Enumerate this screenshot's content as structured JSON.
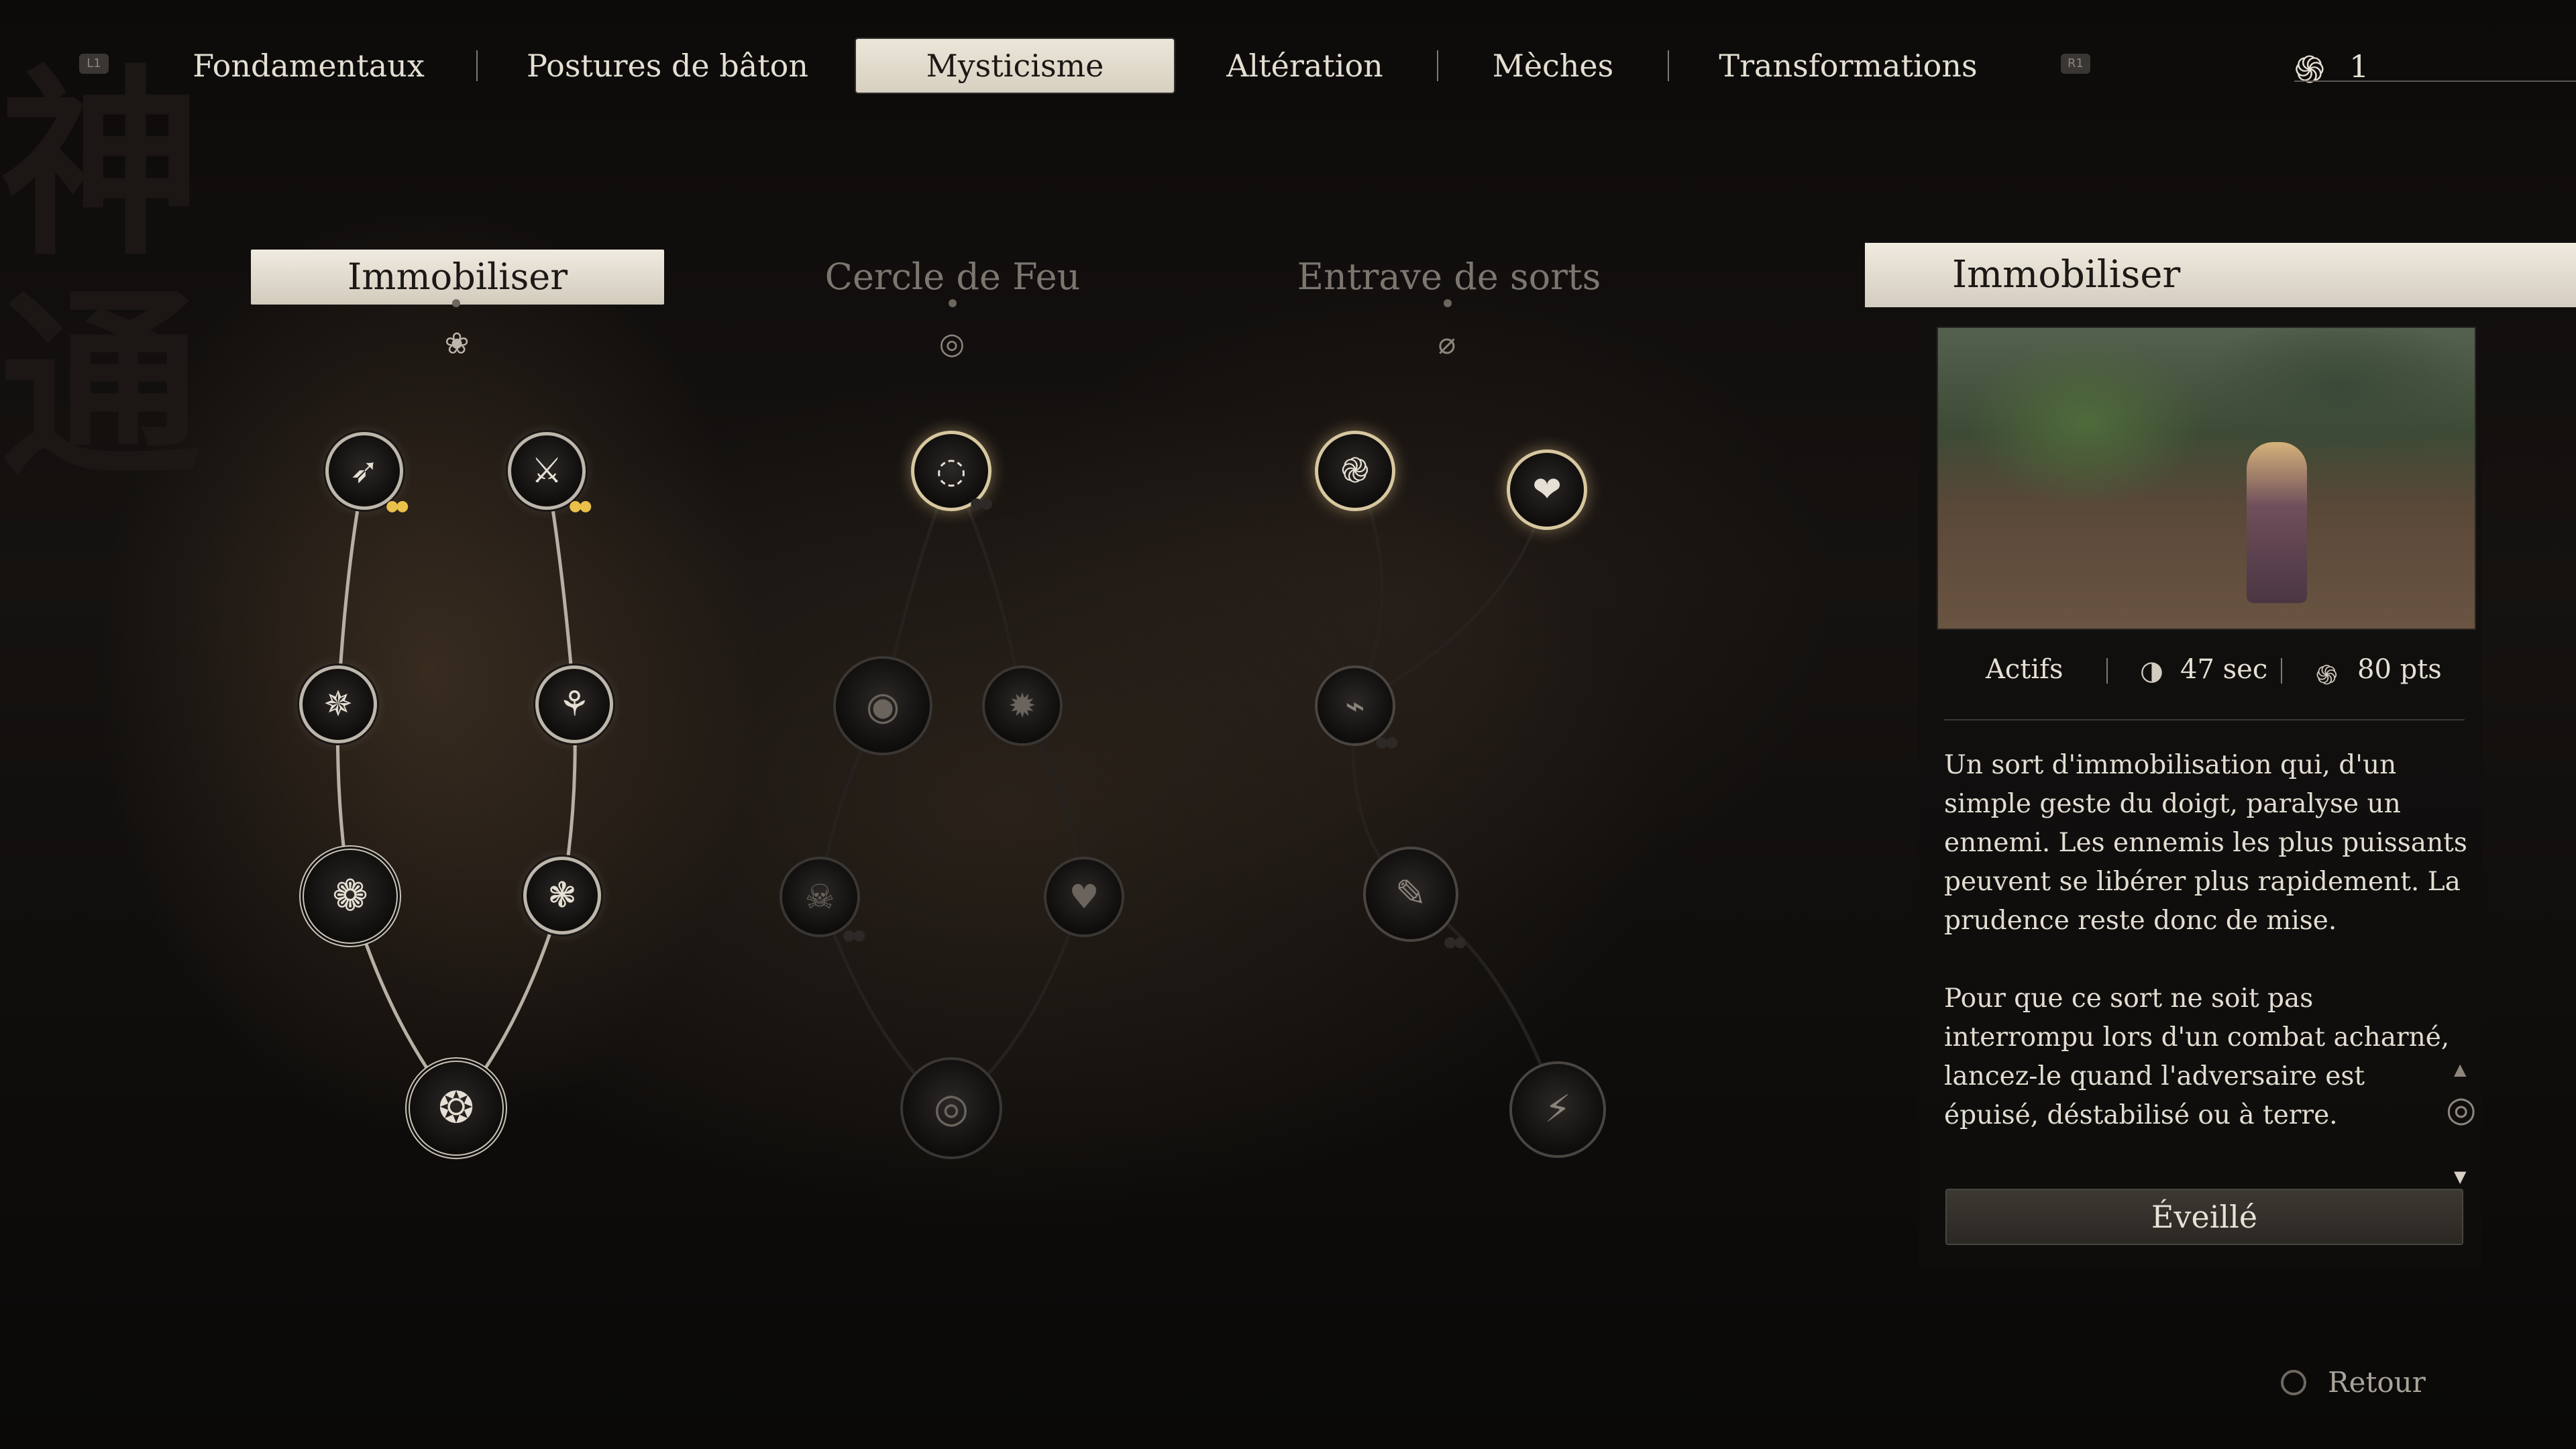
{
  "top_nav": {
    "left_hint": "L1",
    "right_hint": "R1",
    "tabs": [
      {
        "label": "Fondamentaux"
      },
      {
        "label": "Postures de bâton"
      },
      {
        "label": "Mysticisme"
      },
      {
        "label": "Altération"
      },
      {
        "label": "Mèches"
      },
      {
        "label": "Transformations"
      }
    ],
    "active_tab": "Mysticisme",
    "points": "1"
  },
  "trees": [
    {
      "title": "Immobiliser",
      "state": "active"
    },
    {
      "title": "Cercle de Feu",
      "state": "inactive"
    },
    {
      "title": "Entrave de sorts",
      "state": "inactive"
    }
  ],
  "detail": {
    "title": "Immobiliser",
    "type": "Actifs",
    "cooldown": "47 sec",
    "cost": "80 pts",
    "description": [
      "Un sort d'immobilisation qui, d'un simple geste du doigt, paralyse un ennemi. Les ennemis les plus puissants peuvent se libérer plus rapidement. La prudence reste donc de mise.",
      "Pour que ce sort ne soit pas interrompu lors d'un combat acharné, lancez-le quand l'adversaire est épuisé, déstabilisé ou à terre."
    ],
    "status_button": "Éveillé"
  },
  "footer": {
    "back_label": "Retour"
  },
  "icons": {
    "points": "swirl-cloud-icon",
    "cooldown": "moon-timer-icon",
    "cost": "mana-swirl-icon",
    "back": "circle-button-icon"
  },
  "colors": {
    "active_tab_bg": "#e3ddd0",
    "gold_pip": "#e9c04a",
    "panel_bg": "#121010"
  }
}
